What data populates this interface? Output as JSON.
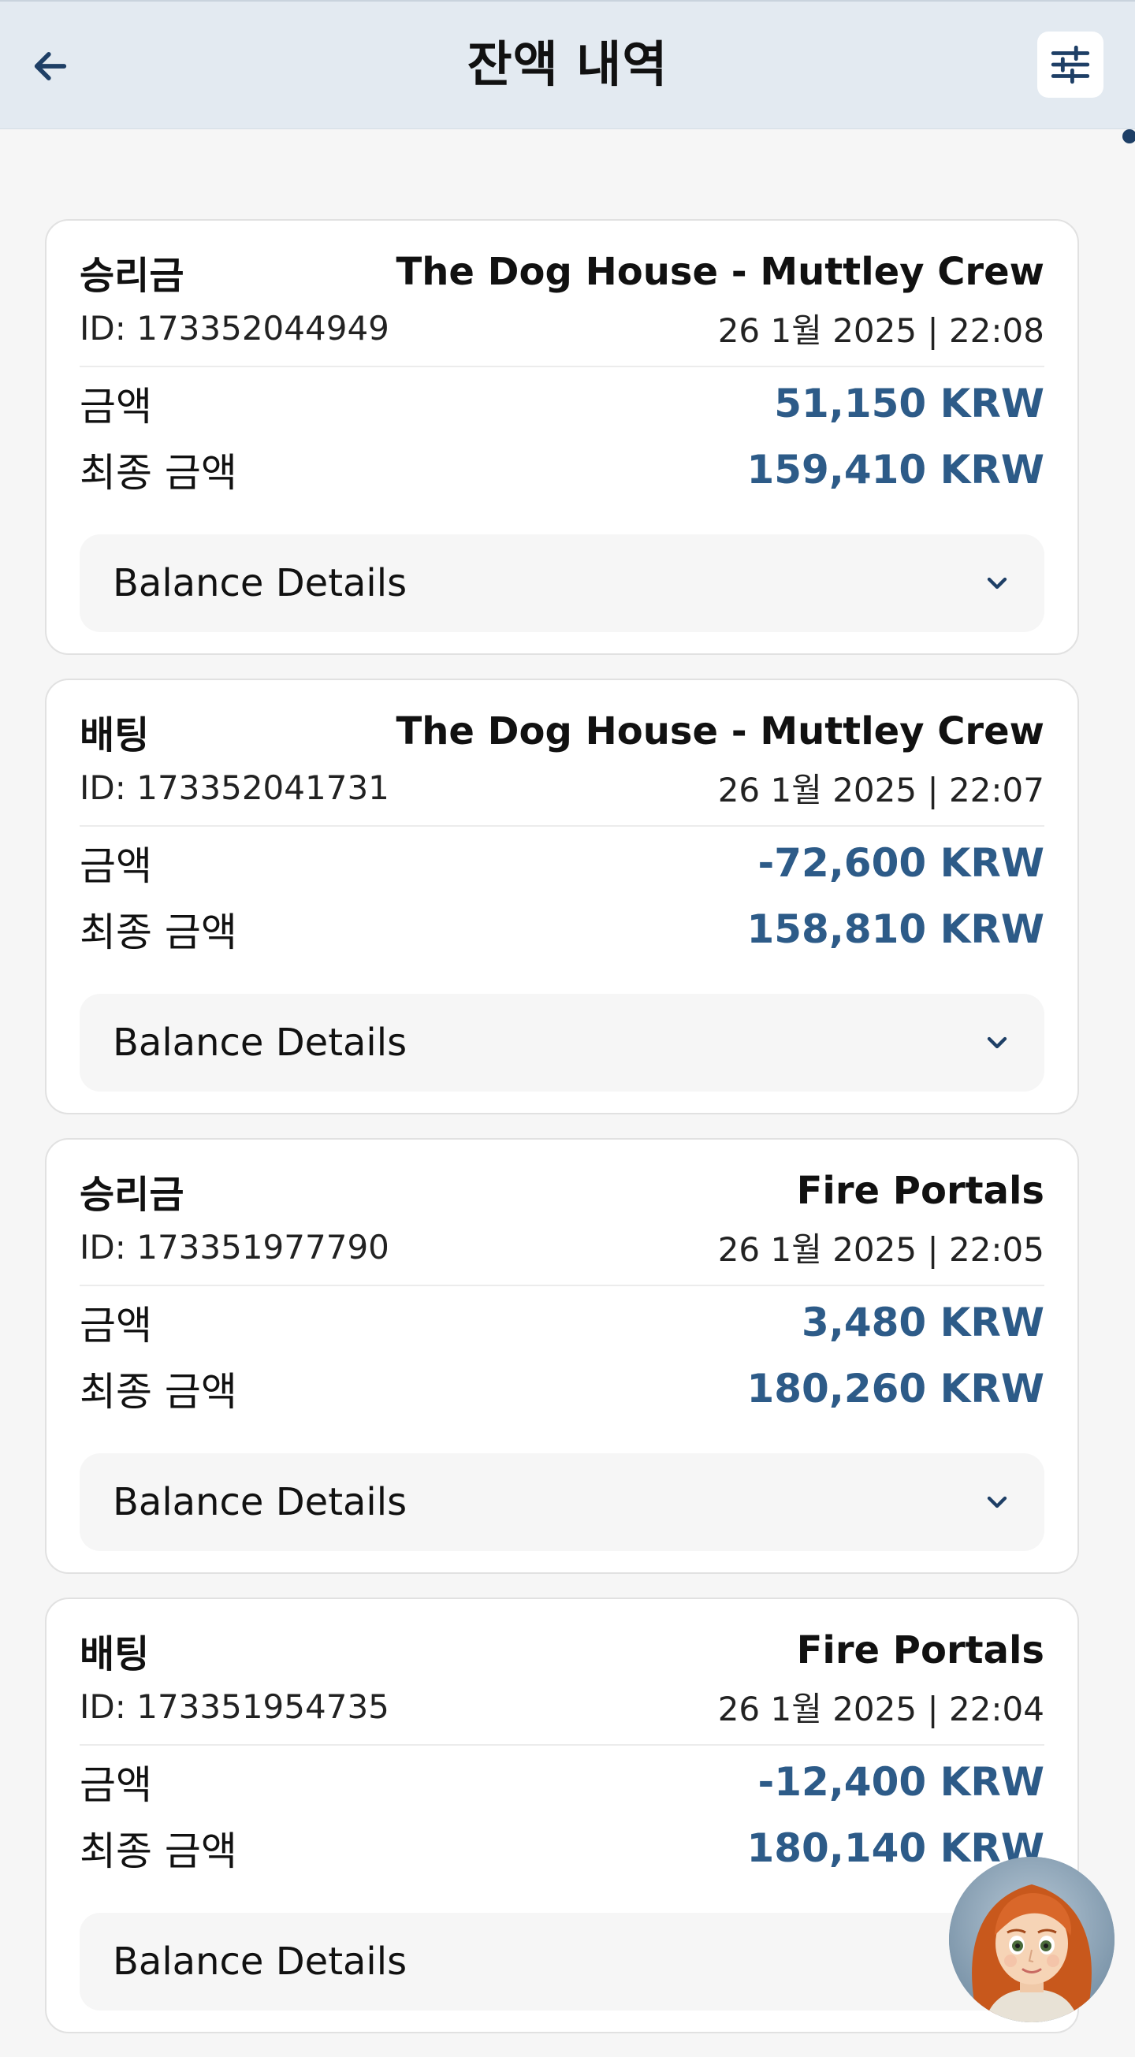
{
  "header": {
    "title": "잔액 내역",
    "back_icon": "arrow-left-icon",
    "filter_icon": "sliders-icon"
  },
  "colors": {
    "header_bg": "#e3eaf1",
    "amount": "#2d5b88",
    "page_bg": "#f6f6f6"
  },
  "labels": {
    "amount": "금액",
    "final_amount": "최종 금액",
    "balance_details": "Balance Details"
  },
  "transactions": [
    {
      "type": "승리금",
      "game": "The Dog House - Muttley Crew",
      "id": "ID: 173352044949",
      "datetime": "26 1월 2025 | 22:08",
      "amount": "51,150 KRW",
      "final_amount": "159,410 KRW"
    },
    {
      "type": "배팅",
      "game": "The Dog House - Muttley Crew",
      "id": "ID: 173352041731",
      "datetime": "26 1월 2025 | 22:07",
      "amount": "-72,600 KRW",
      "final_amount": "158,810 KRW"
    },
    {
      "type": "승리금",
      "game": "Fire Portals",
      "id": "ID: 173351977790",
      "datetime": "26 1월 2025 | 22:05",
      "amount": "3,480 KRW",
      "final_amount": "180,260 KRW"
    },
    {
      "type": "배팅",
      "game": "Fire Portals",
      "id": "ID: 173351954735",
      "datetime": "26 1월 2025 | 22:04",
      "amount": "-12,400 KRW",
      "final_amount": "180,140 KRW"
    }
  ],
  "support_avatar": "support-avatar-icon"
}
